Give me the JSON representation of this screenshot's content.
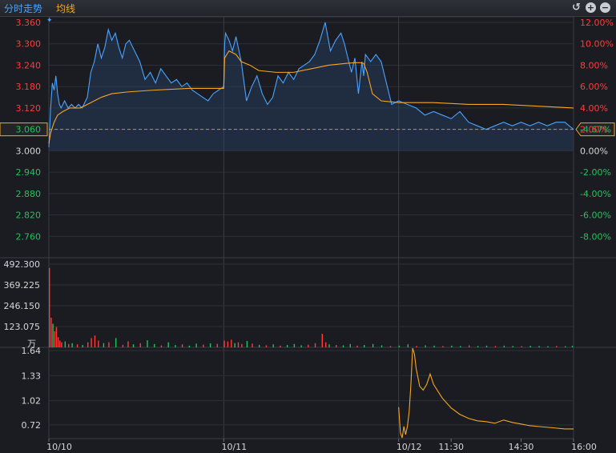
{
  "header": {
    "tab_fenshi": "分时走势",
    "tab_junxian": "均线"
  },
  "icons": [
    "undo-icon",
    "zoom-in-icon",
    "zoom-out-icon"
  ],
  "colors": {
    "up": "#ff3b3b",
    "down": "#21c25a",
    "price_line": "#4aa3ff",
    "avg_line": "#f5a623"
  },
  "chart_data": [
    {
      "type": "line",
      "name": "price",
      "ylim": [
        2.7,
        3.36
      ],
      "y_ticks_left": [
        "3.360",
        "3.300",
        "3.240",
        "3.180",
        "3.120",
        "3.060",
        "3.000",
        "2.940",
        "2.880",
        "2.820",
        "2.760"
      ],
      "y_ticks_right": [
        "12.00%",
        "10.00%",
        "8.00%",
        "6.00%",
        "4.00%",
        "2.00%",
        "0.00%",
        "-2.00%",
        "-4.00%",
        "-6.00%",
        "-8.00%"
      ],
      "ref_price": 3.0,
      "current_price_label": "3.060",
      "current_change_label": "-4.67%",
      "price": {
        "x": [
          0,
          1,
          2,
          3,
          4,
          5,
          6,
          7,
          9,
          11,
          13,
          15,
          17,
          19,
          21,
          22,
          24,
          26,
          28,
          30,
          32,
          34,
          36,
          38,
          40,
          42,
          44,
          46,
          48,
          50,
          52,
          55,
          58,
          61,
          64,
          67,
          70,
          73,
          76,
          79,
          82,
          85,
          88,
          91,
          94,
          97,
          100,
          100.5,
          101,
          103,
          105,
          107,
          110,
          113,
          116,
          119,
          122,
          125,
          128,
          131,
          134,
          137,
          140,
          143,
          146,
          149,
          152,
          155,
          158,
          161,
          164,
          167,
          169,
          171,
          173,
          175,
          177,
          179,
          180,
          181,
          184,
          187,
          190,
          193,
          196,
          200,
          205,
          210,
          215,
          220,
          225,
          230,
          235,
          240,
          245,
          250,
          255,
          260,
          265,
          270,
          275,
          280,
          285,
          290,
          295,
          300
        ],
        "y": [
          3.01,
          3.12,
          3.19,
          3.17,
          3.21,
          3.16,
          3.13,
          3.12,
          3.14,
          3.12,
          3.13,
          3.12,
          3.13,
          3.12,
          3.14,
          3.15,
          3.22,
          3.25,
          3.3,
          3.26,
          3.29,
          3.34,
          3.31,
          3.33,
          3.29,
          3.26,
          3.3,
          3.31,
          3.29,
          3.27,
          3.25,
          3.2,
          3.22,
          3.19,
          3.23,
          3.21,
          3.19,
          3.2,
          3.18,
          3.19,
          3.17,
          3.16,
          3.15,
          3.14,
          3.16,
          3.17,
          3.18,
          3.3,
          3.33,
          3.31,
          3.28,
          3.32,
          3.25,
          3.14,
          3.18,
          3.21,
          3.16,
          3.13,
          3.15,
          3.21,
          3.19,
          3.22,
          3.2,
          3.23,
          3.24,
          3.25,
          3.27,
          3.31,
          3.36,
          3.28,
          3.31,
          3.33,
          3.3,
          3.26,
          3.22,
          3.26,
          3.16,
          3.25,
          3.21,
          3.27,
          3.25,
          3.27,
          3.25,
          3.19,
          3.13,
          3.14,
          3.13,
          3.12,
          3.1,
          3.11,
          3.1,
          3.09,
          3.11,
          3.08,
          3.07,
          3.06,
          3.07,
          3.08,
          3.07,
          3.08,
          3.07,
          3.08,
          3.07,
          3.08,
          3.08,
          3.06
        ]
      },
      "avg": {
        "x": [
          0,
          1,
          3,
          5,
          8,
          12,
          18,
          22,
          26,
          30,
          36,
          45,
          60,
          80,
          100,
          100.5,
          103,
          107,
          110,
          115,
          120,
          130,
          140,
          150,
          160,
          170,
          175,
          178,
          180,
          182,
          185,
          190,
          200,
          220,
          240,
          260,
          280,
          300
        ],
        "y": [
          3.02,
          3.05,
          3.08,
          3.1,
          3.11,
          3.12,
          3.12,
          3.13,
          3.14,
          3.15,
          3.16,
          3.165,
          3.17,
          3.175,
          3.175,
          3.26,
          3.28,
          3.27,
          3.25,
          3.24,
          3.225,
          3.22,
          3.22,
          3.23,
          3.24,
          3.245,
          3.247,
          3.247,
          3.245,
          3.22,
          3.16,
          3.14,
          3.135,
          3.135,
          3.13,
          3.13,
          3.125,
          3.12
        ]
      }
    },
    {
      "type": "bar",
      "name": "volume",
      "unit": "万",
      "ylim": [
        0,
        492.3
      ],
      "y_ticks": [
        "492.300",
        "369.225",
        "246.150",
        "123.075"
      ],
      "bars": [
        {
          "x": 0,
          "v": 470,
          "c": "up"
        },
        {
          "x": 1,
          "v": 175,
          "c": "up"
        },
        {
          "x": 2,
          "v": 140,
          "c": "down"
        },
        {
          "x": 3,
          "v": 95,
          "c": "up"
        },
        {
          "x": 4,
          "v": 120,
          "c": "up"
        },
        {
          "x": 5,
          "v": 60,
          "c": "up"
        },
        {
          "x": 6,
          "v": 40,
          "c": "up"
        },
        {
          "x": 7,
          "v": 30,
          "c": "up"
        },
        {
          "x": 9,
          "v": 35,
          "c": "down"
        },
        {
          "x": 11,
          "v": 20,
          "c": "up"
        },
        {
          "x": 13,
          "v": 25,
          "c": "down"
        },
        {
          "x": 16,
          "v": 18,
          "c": "up"
        },
        {
          "x": 19,
          "v": 14,
          "c": "down"
        },
        {
          "x": 22,
          "v": 30,
          "c": "up"
        },
        {
          "x": 24,
          "v": 55,
          "c": "up"
        },
        {
          "x": 26,
          "v": 70,
          "c": "up"
        },
        {
          "x": 28,
          "v": 40,
          "c": "up"
        },
        {
          "x": 31,
          "v": 25,
          "c": "down"
        },
        {
          "x": 34,
          "v": 30,
          "c": "up"
        },
        {
          "x": 38,
          "v": 55,
          "c": "down"
        },
        {
          "x": 42,
          "v": 15,
          "c": "up"
        },
        {
          "x": 45,
          "v": 35,
          "c": "up"
        },
        {
          "x": 48,
          "v": 18,
          "c": "down"
        },
        {
          "x": 52,
          "v": 25,
          "c": "up"
        },
        {
          "x": 56,
          "v": 42,
          "c": "down"
        },
        {
          "x": 60,
          "v": 20,
          "c": "down"
        },
        {
          "x": 64,
          "v": 12,
          "c": "up"
        },
        {
          "x": 68,
          "v": 30,
          "c": "down"
        },
        {
          "x": 72,
          "v": 14,
          "c": "down"
        },
        {
          "x": 76,
          "v": 18,
          "c": "up"
        },
        {
          "x": 80,
          "v": 10,
          "c": "down"
        },
        {
          "x": 84,
          "v": 22,
          "c": "down"
        },
        {
          "x": 88,
          "v": 16,
          "c": "up"
        },
        {
          "x": 92,
          "v": 24,
          "c": "down"
        },
        {
          "x": 96,
          "v": 20,
          "c": "up"
        },
        {
          "x": 100,
          "v": 40,
          "c": "up"
        },
        {
          "x": 102,
          "v": 35,
          "c": "up"
        },
        {
          "x": 104,
          "v": 45,
          "c": "up"
        },
        {
          "x": 106,
          "v": 25,
          "c": "down"
        },
        {
          "x": 108,
          "v": 30,
          "c": "up"
        },
        {
          "x": 110,
          "v": 20,
          "c": "up"
        },
        {
          "x": 113,
          "v": 38,
          "c": "down"
        },
        {
          "x": 116,
          "v": 22,
          "c": "up"
        },
        {
          "x": 120,
          "v": 15,
          "c": "down"
        },
        {
          "x": 124,
          "v": 12,
          "c": "up"
        },
        {
          "x": 128,
          "v": 18,
          "c": "down"
        },
        {
          "x": 132,
          "v": 10,
          "c": "up"
        },
        {
          "x": 136,
          "v": 14,
          "c": "down"
        },
        {
          "x": 140,
          "v": 20,
          "c": "down"
        },
        {
          "x": 144,
          "v": 12,
          "c": "down"
        },
        {
          "x": 148,
          "v": 16,
          "c": "up"
        },
        {
          "x": 152,
          "v": 25,
          "c": "up"
        },
        {
          "x": 156,
          "v": 80,
          "c": "up"
        },
        {
          "x": 158,
          "v": 30,
          "c": "up"
        },
        {
          "x": 160,
          "v": 18,
          "c": "down"
        },
        {
          "x": 164,
          "v": 14,
          "c": "up"
        },
        {
          "x": 168,
          "v": 12,
          "c": "down"
        },
        {
          "x": 172,
          "v": 20,
          "c": "down"
        },
        {
          "x": 176,
          "v": 10,
          "c": "up"
        },
        {
          "x": 180,
          "v": 14,
          "c": "down"
        },
        {
          "x": 185,
          "v": 20,
          "c": "down"
        },
        {
          "x": 190,
          "v": 12,
          "c": "down"
        },
        {
          "x": 195,
          "v": 8,
          "c": "up"
        },
        {
          "x": 200,
          "v": 10,
          "c": "down"
        },
        {
          "x": 205,
          "v": 18,
          "c": "down"
        },
        {
          "x": 210,
          "v": 8,
          "c": "up"
        },
        {
          "x": 215,
          "v": 12,
          "c": "down"
        },
        {
          "x": 220,
          "v": 10,
          "c": "down"
        },
        {
          "x": 225,
          "v": 8,
          "c": "up"
        },
        {
          "x": 230,
          "v": 10,
          "c": "down"
        },
        {
          "x": 235,
          "v": 8,
          "c": "down"
        },
        {
          "x": 240,
          "v": 12,
          "c": "up"
        },
        {
          "x": 245,
          "v": 8,
          "c": "down"
        },
        {
          "x": 250,
          "v": 10,
          "c": "down"
        },
        {
          "x": 255,
          "v": 8,
          "c": "up"
        },
        {
          "x": 260,
          "v": 10,
          "c": "down"
        },
        {
          "x": 265,
          "v": 8,
          "c": "down"
        },
        {
          "x": 270,
          "v": 7,
          "c": "up"
        },
        {
          "x": 275,
          "v": 9,
          "c": "down"
        },
        {
          "x": 280,
          "v": 8,
          "c": "down"
        },
        {
          "x": 285,
          "v": 7,
          "c": "down"
        },
        {
          "x": 290,
          "v": 8,
          "c": "up"
        },
        {
          "x": 295,
          "v": 7,
          "c": "down"
        },
        {
          "x": 299,
          "v": 9,
          "c": "down"
        }
      ]
    },
    {
      "type": "line",
      "name": "indicator",
      "ylim": [
        0.55,
        1.68
      ],
      "y_ticks": [
        "1.64",
        "1.33",
        "1.02",
        "0.72"
      ],
      "x": [
        200,
        201,
        202,
        203,
        204,
        205,
        206,
        207,
        208,
        209,
        210,
        212,
        214,
        216,
        218,
        220,
        225,
        230,
        235,
        240,
        245,
        250,
        255,
        260,
        265,
        270,
        275,
        280,
        285,
        290,
        295,
        300
      ],
      "y": [
        0.94,
        0.62,
        0.56,
        0.7,
        0.6,
        0.7,
        0.88,
        1.22,
        1.67,
        1.6,
        1.42,
        1.2,
        1.15,
        1.22,
        1.35,
        1.22,
        1.05,
        0.93,
        0.85,
        0.8,
        0.77,
        0.76,
        0.74,
        0.78,
        0.75,
        0.73,
        0.71,
        0.7,
        0.69,
        0.68,
        0.67,
        0.67
      ]
    }
  ],
  "x_axis": {
    "ticks": [
      "10/10",
      "10/11",
      "10/12",
      "11:30",
      "14:30",
      "16:00"
    ],
    "tick_x": [
      0,
      100,
      200,
      230,
      270,
      300
    ],
    "x_range": [
      0,
      300
    ]
  }
}
